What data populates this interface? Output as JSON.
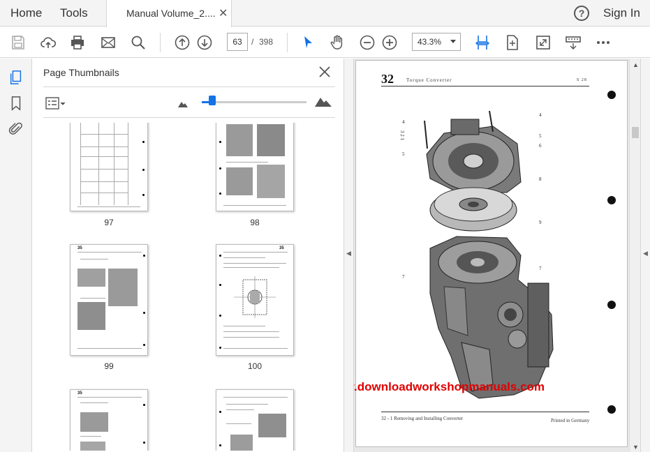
{
  "tabbar": {
    "home": "Home",
    "tools": "Tools",
    "doc_tab": "Manual Volume_2....",
    "close_glyph": "✕",
    "help_glyph": "?",
    "sign_in": "Sign In"
  },
  "toolbar": {
    "current_page": "63",
    "page_separator": "/",
    "total_pages": "398",
    "zoom": "43.3%"
  },
  "panel": {
    "title": "Page Thumbnails",
    "thumbnail_size_level": 0.1,
    "thumbnails": [
      {
        "label": "97"
      },
      {
        "label": "98"
      },
      {
        "label": "99"
      },
      {
        "label": "100"
      },
      {
        "label": "",
        "header_num": "35"
      },
      {
        "label": "",
        "header_num": "35"
      }
    ],
    "thumb_header_35": "35",
    "thumb_header_a": "35",
    "thumb_header_b": "35"
  },
  "document_page": {
    "page_number": "32",
    "header_title": "Torque Converter",
    "header_code": "S 28",
    "footer_left": "32 - 1   Removing and Installing Converter",
    "footer_right": "Printed in Germany",
    "watermark": "www.downloadworkshopmanuals.com",
    "callouts": [
      "4",
      "3 2 1",
      "5",
      "4",
      "5",
      "6",
      "8",
      "9",
      "7",
      "7"
    ]
  },
  "colors": {
    "accent": "#1473e6",
    "watermark": "#e00000",
    "chrome_bg": "#f4f4f4"
  },
  "icons": [
    "save-icon",
    "cloud-upload-icon",
    "print-icon",
    "mail-icon",
    "search-icon",
    "page-up-icon",
    "page-down-icon",
    "select-cursor-icon",
    "hand-tool-icon",
    "zoom-out-icon",
    "zoom-in-icon",
    "fit-width-icon",
    "fit-page-icon",
    "full-screen-icon",
    "read-mode-icon",
    "more-icon",
    "thumbnails-icon",
    "bookmark-icon",
    "attachment-icon"
  ]
}
